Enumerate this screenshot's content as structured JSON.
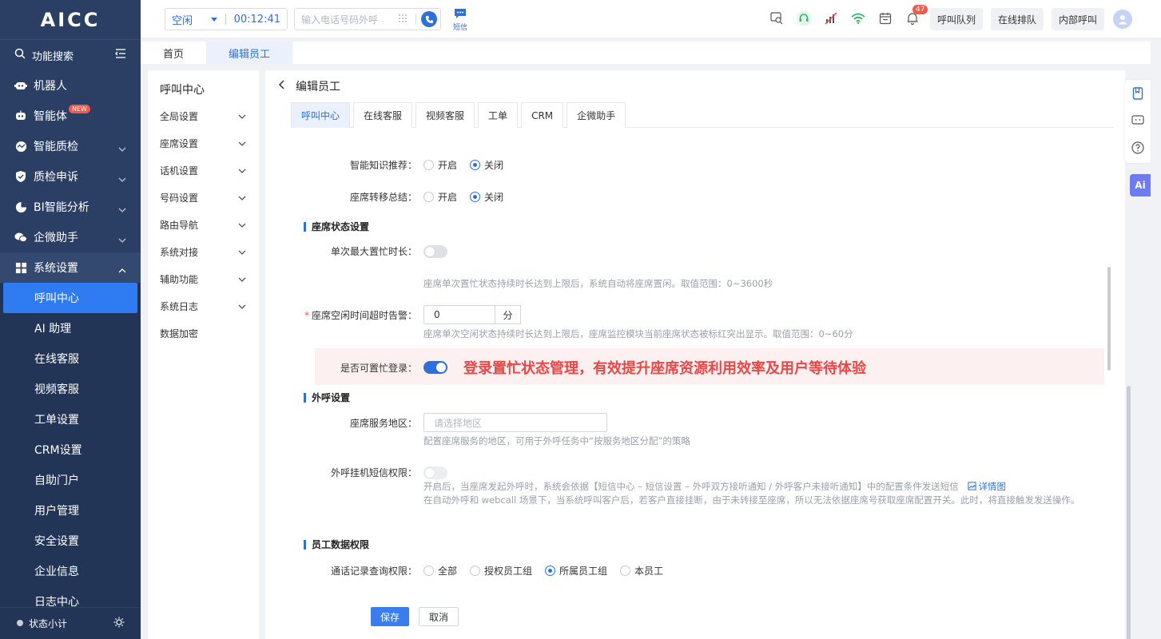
{
  "app": {
    "logo": "AICC"
  },
  "sidebar": {
    "search_label": "功能搜索",
    "items": [
      {
        "label": "机器人",
        "icon": "robot-icon",
        "has_chevron": false
      },
      {
        "label": "智能体",
        "icon": "agent-icon",
        "badge": "NEW",
        "has_chevron": false
      },
      {
        "label": "智能质检",
        "icon": "quality-icon",
        "has_chevron": true
      },
      {
        "label": "质检申诉",
        "icon": "shield-icon",
        "has_chevron": true
      },
      {
        "label": "BI智能分析",
        "icon": "pie-chart-icon",
        "has_chevron": true
      },
      {
        "label": "企微助手",
        "icon": "chat-icon",
        "has_chevron": true
      },
      {
        "label": "系统设置",
        "icon": "grid-icon",
        "has_chevron": true,
        "open": true
      }
    ],
    "sub_items": [
      "呼叫中心",
      "AI 助理",
      "在线客服",
      "视频客服",
      "工单设置",
      "CRM设置",
      "自助门户",
      "用户管理",
      "安全设置",
      "企业信息",
      "日志中心"
    ],
    "active_sub": "呼叫中心",
    "footer_label": "状态小计"
  },
  "topbar": {
    "status": "空闲",
    "timer": "00:12:41",
    "phone_placeholder": "输入电话号码外呼",
    "sms_label": "短信",
    "bell_count": "47",
    "buttons": [
      "呼叫队列",
      "在线排队",
      "内部呼叫"
    ]
  },
  "pagetabs": [
    "首页",
    "编辑员工"
  ],
  "submenu": {
    "title": "呼叫中心",
    "items": [
      {
        "label": "全局设置",
        "chevron": true
      },
      {
        "label": "座席设置",
        "chevron": true
      },
      {
        "label": "话机设置",
        "chevron": true
      },
      {
        "label": "号码设置",
        "chevron": true
      },
      {
        "label": "路由导航",
        "chevron": true
      },
      {
        "label": "系统对接",
        "chevron": true
      },
      {
        "label": "辅助功能",
        "chevron": true
      },
      {
        "label": "系统日志",
        "chevron": true
      },
      {
        "label": "数据加密",
        "chevron": false
      }
    ]
  },
  "main": {
    "title": "编辑员工",
    "tabs": [
      "呼叫中心",
      "在线客服",
      "视频客服",
      "工单",
      "CRM",
      "企微助手"
    ],
    "active_tab": "呼叫中心",
    "fields": {
      "knowledge": {
        "label": "智能知识推荐：",
        "options": [
          "开启",
          "关闭"
        ],
        "selected": "关闭"
      },
      "transfer": {
        "label": "座席转移总结：",
        "options": [
          "开启",
          "关闭"
        ],
        "selected": "关闭"
      },
      "section_status": "座席状态设置",
      "max_busy": {
        "label": "单次最大置忙时长：",
        "on": false,
        "hint": "座席单次置忙状态持续时长达到上限后，系统自动将座席置闲。取值范围：0~3600秒"
      },
      "idle_alarm": {
        "label": "座席空闲时间超时告警：",
        "required": true,
        "value": "0",
        "unit": "分",
        "hint": "座席单次空闲状态持续时长达到上限后，座席监控模块当前座席状态被标红突出显示。取值范围：0~60分"
      },
      "busy_login": {
        "label": "是否可置忙登录：",
        "on": true,
        "highlight": "登录置忙状态管理，有效提升座席资源利用效率及用户等待体验"
      },
      "section_outbound": "外呼设置",
      "region": {
        "label": "座席服务地区：",
        "placeholder": "请选择地区",
        "hint": "配置座席服务的地区，可用于外呼任务中“按服务地区分配”的策略"
      },
      "hangup_sms": {
        "label": "外呼挂机短信权限：",
        "on": false,
        "hint_line1": "开启后，当座席发起外呼时，系统会依据【短信中心 – 短信设置 – 外呼双方接听通知 / 外呼客户未接听通知】中的配置条件发送短信",
        "hint_link": "详情图",
        "hint_line2": "在自动外呼和 webcall 场景下，当系统呼叫客户后，若客户直接挂断，由于未转接至座席，所以无法依据座席号获取座席配置开关。此时，将直接触发发送操作。"
      },
      "section_data": "员工数据权限",
      "call_record": {
        "label": "通话记录查询权限：",
        "options": [
          "全部",
          "授权员工组",
          "所属员工组",
          "本员工"
        ],
        "selected": "所属员工组"
      }
    },
    "save_label": "保存",
    "cancel_label": "取消"
  },
  "rightbar": {
    "ai_label": "Ai"
  },
  "colors": {
    "sidebar": "#2b3f64",
    "primary": "#2f6fd8",
    "highlight_bg": "#fdf0f0",
    "highlight_text": "#ef4444"
  }
}
